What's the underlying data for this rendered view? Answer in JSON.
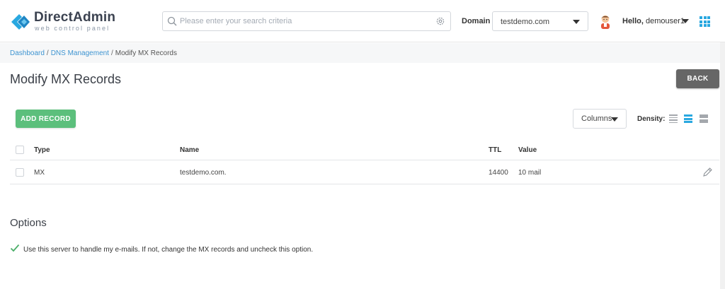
{
  "brand": {
    "name": "DirectAdmin",
    "tagline": "web control panel"
  },
  "search": {
    "placeholder": "Please enter your search criteria",
    "value": ""
  },
  "domain": {
    "label": "Domain",
    "selected": "testdemo.com"
  },
  "user": {
    "greeting": "Hello,",
    "name": "demouser1"
  },
  "breadcrumb": {
    "items": [
      "Dashboard",
      "DNS Management",
      "Modify MX Records"
    ],
    "separator": "/"
  },
  "page": {
    "title": "Modify MX Records",
    "back_label": "BACK"
  },
  "toolbar": {
    "add_label": "ADD RECORD",
    "columns_label": "Columns",
    "density_label": "Density:"
  },
  "table": {
    "headers": {
      "type": "Type",
      "name": "Name",
      "ttl": "TTL",
      "value": "Value"
    },
    "rows": [
      {
        "type": "MX",
        "name": "testdemo.com.",
        "ttl": "14400",
        "value": "10 mail"
      }
    ]
  },
  "options": {
    "title": "Options",
    "handle_email_label": "Use this server to handle my e-mails. If not, change the MX records and uncheck this option.",
    "handle_email_checked": true
  },
  "colors": {
    "brand_blue": "#29a8e0",
    "link": "#3e94d1",
    "add_green": "#5cbf7c",
    "back_gray": "#666666",
    "check_green": "#4caf6a"
  },
  "icons": [
    "directadmin-logo-icon",
    "search-icon",
    "gear-icon",
    "chevron-down-icon",
    "avatar-icon",
    "apps-grid-icon",
    "density-compact-icon",
    "density-normal-icon",
    "density-wide-icon",
    "pencil-icon",
    "check-icon"
  ]
}
